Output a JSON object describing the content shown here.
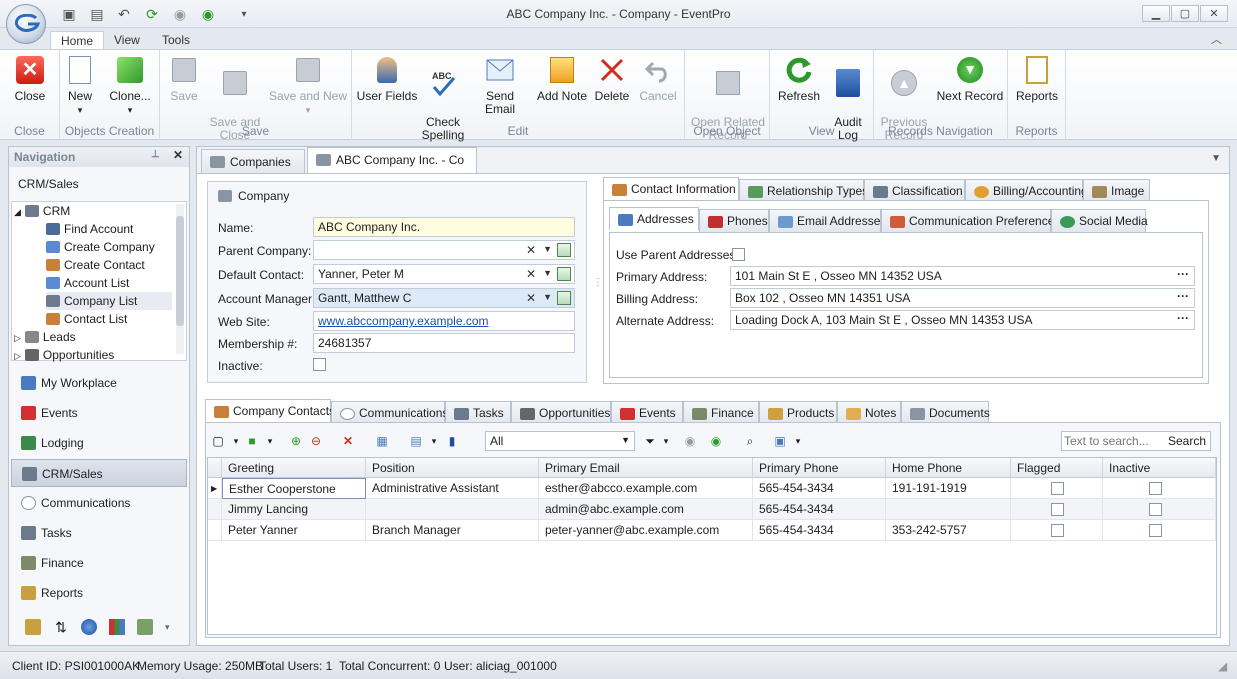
{
  "window": {
    "title": "ABC Company Inc. - Company - EventPro"
  },
  "ribbon_tabs": [
    "Home",
    "View",
    "Tools"
  ],
  "ribbon": {
    "groups": [
      {
        "caption": "Close",
        "buttons": [
          {
            "label": "Close",
            "icon": "close-red-icon"
          }
        ]
      },
      {
        "caption": "Objects Creation",
        "buttons": [
          {
            "label": "New",
            "icon": "new-document-icon"
          },
          {
            "label": "Clone...",
            "icon": "clone-cubes-icon"
          }
        ]
      },
      {
        "caption": "Save",
        "buttons": [
          {
            "label": "Save",
            "icon": "save-icon"
          },
          {
            "label": "Save and\nClose",
            "icon": "save-close-icon"
          },
          {
            "label": "Save and New",
            "icon": "save-new-icon"
          }
        ]
      },
      {
        "caption": "Edit",
        "buttons": [
          {
            "label": "User Fields",
            "icon": "user-fields-icon"
          },
          {
            "label": "Check\nSpelling",
            "icon": "spellcheck-icon"
          },
          {
            "label": "Send Email",
            "icon": "envelope-icon"
          },
          {
            "label": "Add Note",
            "icon": "note-icon"
          },
          {
            "label": "Delete",
            "icon": "delete-x-icon"
          },
          {
            "label": "Cancel",
            "icon": "undo-icon"
          }
        ]
      },
      {
        "caption": "Open Object",
        "buttons": [
          {
            "label": "Open Related\nRecord",
            "icon": "related-record-icon"
          }
        ]
      },
      {
        "caption": "View",
        "buttons": [
          {
            "label": "Refresh",
            "icon": "refresh-icon"
          },
          {
            "label": "Audit\nLog",
            "icon": "audit-log-icon"
          }
        ]
      },
      {
        "caption": "Records Navigation",
        "buttons": [
          {
            "label": "Previous\nRecord",
            "icon": "previous-record-icon"
          },
          {
            "label": "Next Record",
            "icon": "next-record-icon"
          }
        ]
      },
      {
        "caption": "Reports",
        "buttons": [
          {
            "label": "Reports",
            "icon": "reports-icon"
          }
        ]
      }
    ]
  },
  "nav": {
    "header": "Navigation",
    "section_title": "CRM/Sales",
    "tree": [
      {
        "label": "CRM",
        "level": 0,
        "color": "#6b7a8c"
      },
      {
        "label": "Find Account",
        "level": 1,
        "color": "#4a6a9a"
      },
      {
        "label": "Create Company",
        "level": 1,
        "color": "#5a8ad0"
      },
      {
        "label": "Create Contact",
        "level": 1,
        "color": "#c8803a"
      },
      {
        "label": "Account List",
        "level": 1,
        "color": "#5a8ad0"
      },
      {
        "label": "Company List",
        "level": 1,
        "color": "#6b7a8c"
      },
      {
        "label": "Contact List",
        "level": 1,
        "color": "#c8803a"
      },
      {
        "label": "Leads",
        "level": 0,
        "color": "#888888"
      },
      {
        "label": "Opportunities",
        "level": 0,
        "color": "#666666"
      }
    ],
    "buttons": [
      {
        "label": "My Workplace",
        "color": "#4a7ac0"
      },
      {
        "label": "Events",
        "color": "#d03030"
      },
      {
        "label": "Lodging",
        "color": "#3a8a4a"
      },
      {
        "label": "CRM/Sales",
        "color": "#6b7a8c"
      },
      {
        "label": "Communications",
        "color": "#c0c8d4"
      },
      {
        "label": "Tasks",
        "color": "#6b7a8c"
      },
      {
        "label": "Finance",
        "color": "#7a8a6a"
      },
      {
        "label": "Reports",
        "color": "#c8a040"
      }
    ]
  },
  "doc_tabs": [
    "Companies",
    "ABC Company Inc. - Co"
  ],
  "company": {
    "group_title": "Company",
    "name_label": "Name:",
    "name": "ABC Company Inc.",
    "parent_label": "Parent Company:",
    "parent": "",
    "contact_label": "Default Contact:",
    "contact": "Yanner, Peter M",
    "manager_label": "Account Manager:",
    "manager": "Gantt, Matthew C",
    "web_label": "Web Site:",
    "web": "www.abccompany.example.com",
    "member_label": "Membership #:",
    "member": "24681357",
    "inactive_label": "Inactive:"
  },
  "info_tabs": [
    "Contact Information",
    "Relationship Types",
    "Classification",
    "Billing/Accounting",
    "Image"
  ],
  "sub_tabs": [
    "Addresses",
    "Phones",
    "Email Addresses",
    "Communication Preferences",
    "Social Media"
  ],
  "addresses": {
    "use_parent_label": "Use Parent Addresses:",
    "primary_label": "Primary Address:",
    "primary": "101 Main St E , Osseo MN 14352 USA",
    "billing_label": "Billing Address:",
    "billing": "Box 102 , Osseo MN 14351 USA",
    "alternate_label": "Alternate Address:",
    "alternate": "Loading Dock A, 103 Main St E , Osseo MN 14353 USA"
  },
  "bottom_tabs": [
    "Company Contacts",
    "Communications",
    "Tasks",
    "Opportunities",
    "Events",
    "Finance",
    "Products",
    "Notes",
    "Documents"
  ],
  "grid_toolbar": {
    "filter_value": "All",
    "search_placeholder": "Text to search...",
    "search_button": "Search"
  },
  "contacts": {
    "columns": [
      "Greeting",
      "Position",
      "Primary Email",
      "Primary Phone",
      "Home Phone",
      "Flagged",
      "Inactive"
    ],
    "rows": [
      [
        "Esther Cooperstone",
        "Administrative Assistant",
        "esther@abcco.example.com",
        "565-454-3434",
        "191-191-1919"
      ],
      [
        "Jimmy Lancing",
        "",
        "admin@abc.example.com",
        "565-454-3434",
        ""
      ],
      [
        "Peter Yanner",
        "Branch Manager",
        "peter-yanner@abc.example.com",
        "565-454-3434",
        "353-242-5757"
      ]
    ]
  },
  "status": {
    "client": "Client ID: PSI001000AK",
    "memory": "Memory Usage: 250MB",
    "users": "Total Users: 1",
    "concurrent": "Total Concurrent: 0",
    "user": "User: aliciag_001000"
  }
}
